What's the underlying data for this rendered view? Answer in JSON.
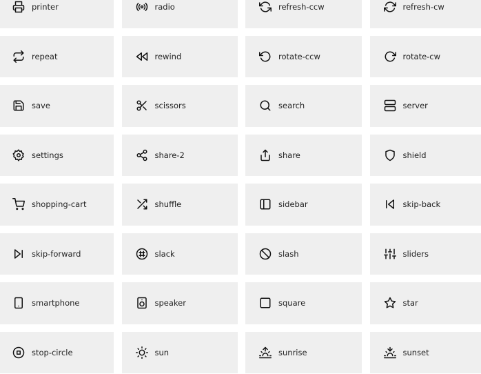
{
  "icons": [
    "printer",
    "radio",
    "refresh-ccw",
    "refresh-cw",
    "repeat",
    "rewind",
    "rotate-ccw",
    "rotate-cw",
    "save",
    "scissors",
    "search",
    "server",
    "settings",
    "share-2",
    "share",
    "shield",
    "shopping-cart",
    "shuffle",
    "sidebar",
    "skip-back",
    "skip-forward",
    "slack",
    "slash",
    "sliders",
    "smartphone",
    "speaker",
    "square",
    "star",
    "stop-circle",
    "sun",
    "sunrise",
    "sunset"
  ]
}
